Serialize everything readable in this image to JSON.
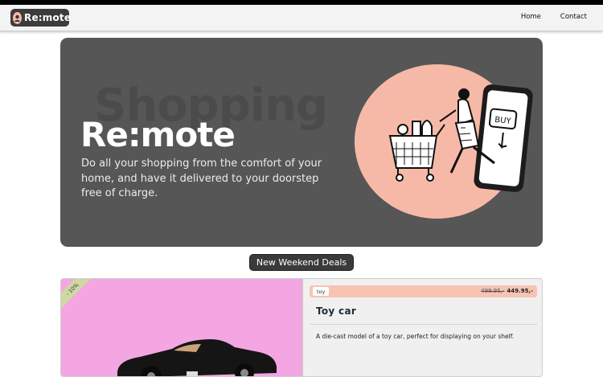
{
  "navbar": {
    "brand": "Re:mote",
    "links": [
      "Home",
      "Contact"
    ]
  },
  "hero": {
    "watermark": "Shopping",
    "title": "Re:mote",
    "description": "Do all your shopping from the comfort of your home, and have it delivered to your doorstep free of charge.",
    "illustration_button": "BUY"
  },
  "deals": {
    "heading": "New Weekend Deals",
    "items": [
      {
        "discount": "- 10%",
        "category": "toy",
        "old_price": "499.95,-",
        "new_price": "449.95,-",
        "title": "Toy car",
        "description": "A die-cast model of a toy car, perfect for displaying on your shelf."
      }
    ]
  },
  "colors": {
    "navbar_bg": "#f3f3f3",
    "hero_bg": "#565656",
    "accent_peach": "#f7b9a7",
    "deal_image_bg": "#f3a6e1",
    "pill_bg": "#3a3a3a"
  }
}
